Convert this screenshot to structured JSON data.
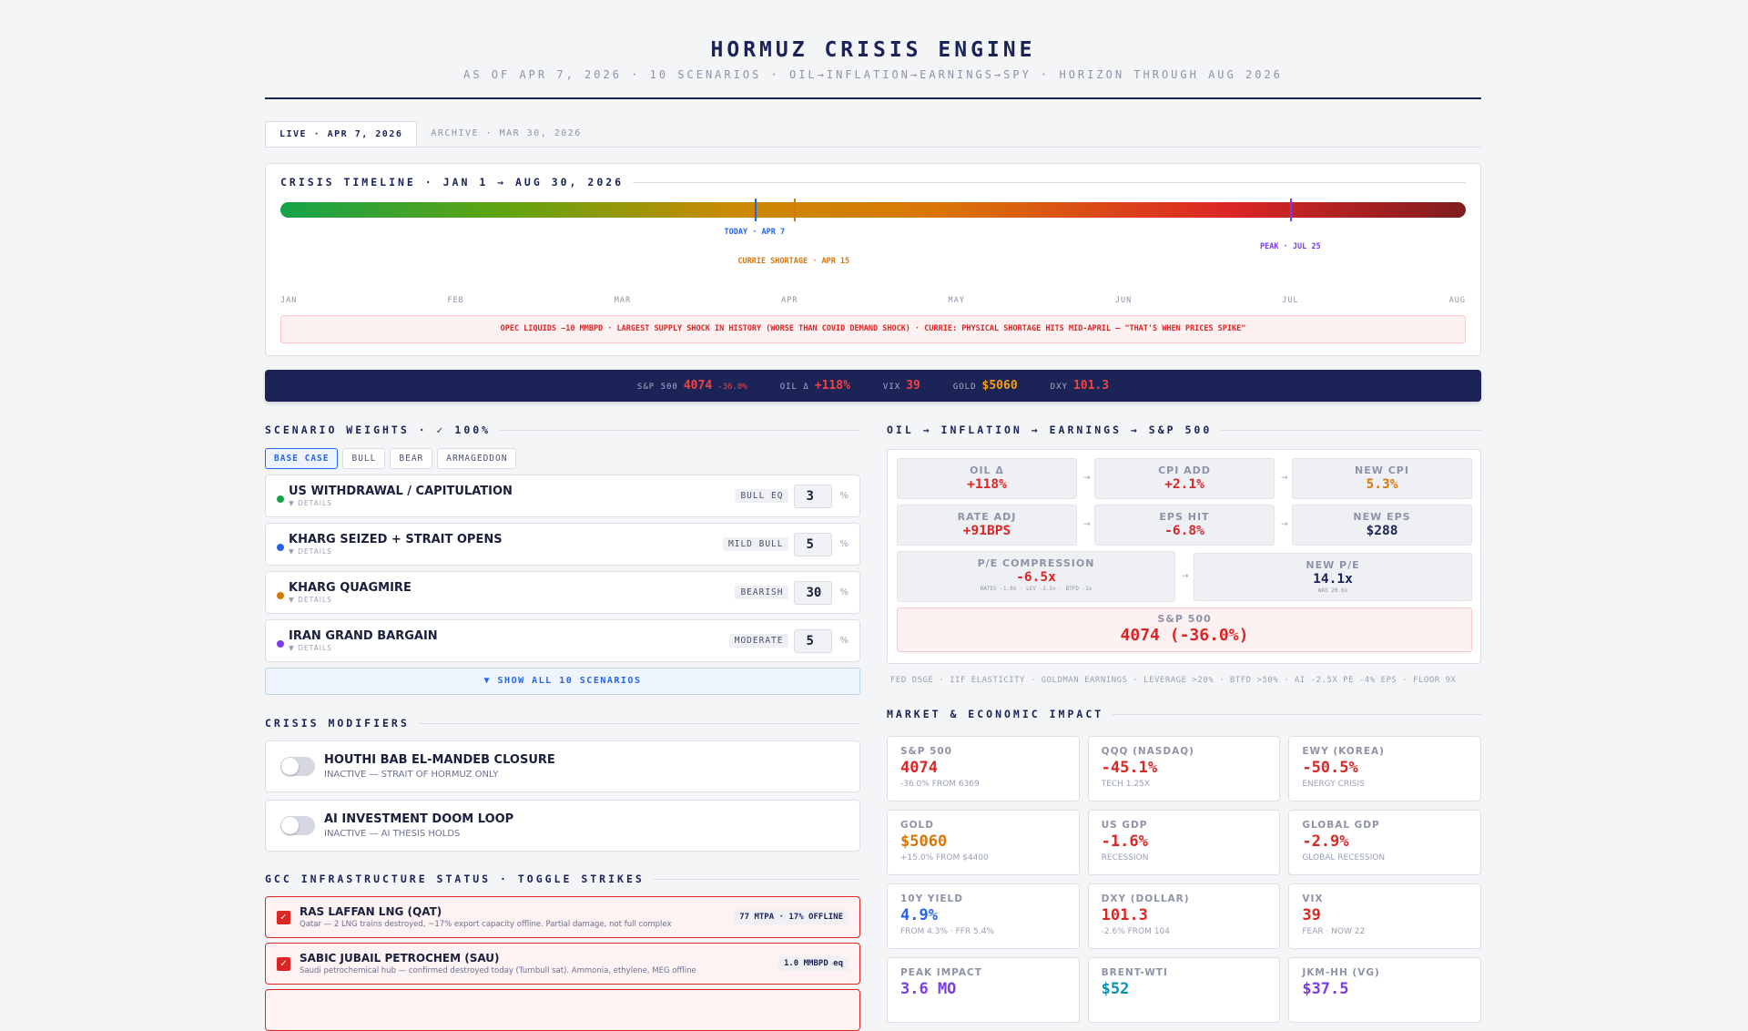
{
  "header": {
    "title": "HORMUZ CRISIS ENGINE",
    "subtitle": "AS OF APR 7, 2026 · 10 SCENARIOS · OIL→INFLATION→EARNINGS→SPY · HORIZON THROUGH AUG 2026"
  },
  "tabs": [
    {
      "label": "LIVE · APR 7, 2026"
    },
    {
      "label": "ARCHIVE · MAR 30, 2026"
    }
  ],
  "timeline": {
    "title": "CRISIS TIMELINE · JAN 1 → AUG 30, 2026",
    "markers": {
      "today": "TODAY · APR 7",
      "currie": "CURRIE SHORTAGE · APR 15",
      "peak": "PEAK · JUL 25"
    },
    "months": [
      "JAN",
      "FEB",
      "MAR",
      "APR",
      "MAY",
      "JUN",
      "JUL",
      "AUG"
    ],
    "alert": "OPEC LIQUIDS −10 MMBPD · LARGEST SUPPLY SHOCK IN HISTORY (WORSE THAN COVID DEMAND SHOCK) · CURRIE: PHYSICAL SHORTAGE HITS MID-APRIL — \"THAT'S WHEN PRICES SPIKE\""
  },
  "ticker": [
    {
      "label": "S&P 500",
      "value": "4074",
      "change": "-36.0%",
      "color": "#ef4444"
    },
    {
      "label": "OIL Δ",
      "value": "+118%",
      "color": "#ef4444"
    },
    {
      "label": "VIX",
      "value": "39",
      "color": "#ef4444"
    },
    {
      "label": "GOLD",
      "value": "$5060",
      "color": "#f59e0b"
    },
    {
      "label": "DXY",
      "value": "101.3",
      "color": "#ef4444"
    }
  ],
  "scenarios": {
    "title": "SCENARIO WEIGHTS · ✓ 100%",
    "presets": [
      "BASE CASE",
      "BULL",
      "BEAR",
      "ARMAGEDDON"
    ],
    "details_label": "▼ DETAILS",
    "pct_sign": "%",
    "items": [
      {
        "name": "US WITHDRAWAL / CAPITULATION",
        "tag": "BULL EQ",
        "weight": "3",
        "color": "#16a34a"
      },
      {
        "name": "KHARG SEIZED + STRAIT OPENS",
        "tag": "MILD BULL",
        "weight": "5",
        "color": "#2563eb"
      },
      {
        "name": "KHARG QUAGMIRE",
        "tag": "BEARISH",
        "weight": "30",
        "color": "#d97706"
      },
      {
        "name": "IRAN GRAND BARGAIN",
        "tag": "MODERATE",
        "weight": "5",
        "color": "#7c3aed"
      }
    ],
    "show_all": "▼ SHOW ALL 10 SCENARIOS"
  },
  "modifiers": {
    "title": "CRISIS MODIFIERS",
    "items": [
      {
        "name": "HOUTHI BAB EL-MANDEB CLOSURE",
        "status": "INACTIVE — STRAIT OF HORMUZ ONLY"
      },
      {
        "name": "AI INVESTMENT DOOM LOOP",
        "status": "INACTIVE — AI THESIS HOLDS"
      }
    ]
  },
  "gcc": {
    "title": "GCC INFRASTRUCTURE STATUS · TOGGLE STRIKES",
    "items": [
      {
        "name": "RAS LAFFAN LNG (QAT)",
        "desc": "Qatar — 2 LNG trains destroyed, ~17% export capacity offline. Partial damage, not full complex",
        "tag": "77 MTPA · 17% OFFLINE"
      },
      {
        "name": "SABIC JUBAIL PETROCHEM (SAU)",
        "desc": "Saudi petrochemical hub — confirmed destroyed today (Turnbull sat). Ammonia, ethylene, MEG offline",
        "tag": "1.0 MMBPD eq"
      }
    ]
  },
  "flow": {
    "title": "OIL → INFLATION → EARNINGS → S&P 500",
    "oil": {
      "label": "OIL Δ",
      "value": "+118%"
    },
    "cpi_add": {
      "label": "CPI ADD",
      "value": "+2.1%"
    },
    "new_cpi": {
      "label": "NEW CPI",
      "value": "5.3%"
    },
    "rate": {
      "label": "RATE ADJ",
      "value": "+91BPS"
    },
    "eps_hit": {
      "label": "EPS HIT",
      "value": "-6.8%"
    },
    "new_eps": {
      "label": "NEW EPS",
      "value": "$288"
    },
    "pe": {
      "label": "P/E COMPRESSION",
      "value": "-6.5x",
      "sub": "RATES -1.0x · LEV -2.5x · BTFD -1x"
    },
    "new_pe": {
      "label": "NEW P/E",
      "value": "14.1x",
      "sub": "WAS 20.6x"
    },
    "spx": {
      "label": "S&P 500",
      "value": "4074 (-36.0%)"
    },
    "arrow": "→",
    "footnote": "FED DSGE · IIF ELASTICITY · GOLDMAN EARNINGS · LEVERAGE >20% · BTFD >50% · AI -2.5X PE -4% EPS · FLOOR 9X"
  },
  "market": {
    "title": "MARKET & ECONOMIC IMPACT",
    "cards": [
      {
        "label": "S&P 500",
        "value": "4074",
        "sub": "-36.0% FROM 6369",
        "color": "#dc2626"
      },
      {
        "label": "QQQ (NASDAQ)",
        "value": "-45.1%",
        "sub": "TECH 1.25X",
        "color": "#dc2626"
      },
      {
        "label": "EWY (KOREA)",
        "value": "-50.5%",
        "sub": "ENERGY CRISIS",
        "color": "#dc2626"
      },
      {
        "label": "GOLD",
        "value": "$5060",
        "sub": "+15.0% FROM $4400",
        "color": "#d97706"
      },
      {
        "label": "US GDP",
        "value": "-1.6%",
        "sub": "RECESSION",
        "color": "#dc2626"
      },
      {
        "label": "GLOBAL GDP",
        "value": "-2.9%",
        "sub": "GLOBAL RECESSION",
        "color": "#dc2626"
      },
      {
        "label": "10Y YIELD",
        "value": "4.9%",
        "sub": "FROM 4.3% · FFR 5.4%",
        "color": "#2563eb"
      },
      {
        "label": "DXY (DOLLAR)",
        "value": "101.3",
        "sub": "-2.6% FROM 104",
        "color": "#dc2626"
      },
      {
        "label": "VIX",
        "value": "39",
        "sub": "FEAR · NOW 22",
        "color": "#dc2626"
      },
      {
        "label": "PEAK IMPACT",
        "value": "3.6 MO",
        "sub": "",
        "color": "#7c3aed"
      },
      {
        "label": "BRENT-WTI",
        "value": "$52",
        "sub": "",
        "color": "#0891b2"
      },
      {
        "label": "JKM-HH (VG)",
        "value": "$37.5",
        "sub": "",
        "color": "#7c3aed"
      }
    ]
  }
}
